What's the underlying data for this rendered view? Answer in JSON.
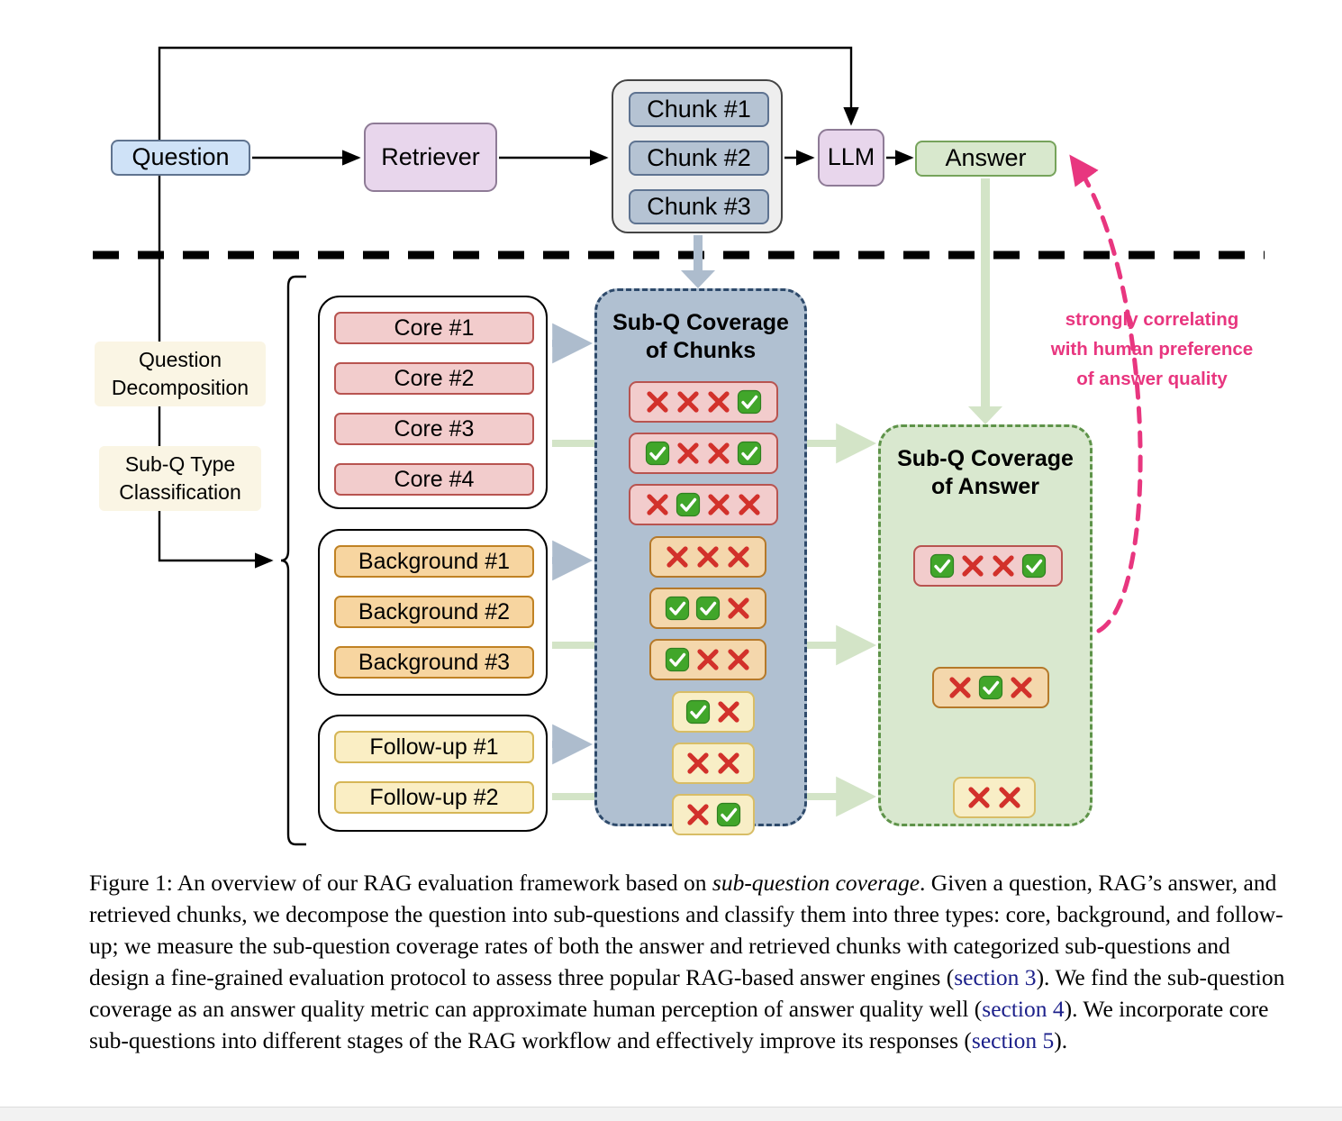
{
  "pipeline": {
    "question": "Question",
    "retriever": "Retriever",
    "llm": "LLM",
    "answer": "Answer",
    "chunks": [
      "Chunk #1",
      "Chunk #2",
      "Chunk #3"
    ]
  },
  "stages": {
    "decomposition": "Question\nDecomposition",
    "classification": "Sub-Q Type\nClassification"
  },
  "subquestions": {
    "core": [
      "Core #1",
      "Core #2",
      "Core #3",
      "Core #4"
    ],
    "background": [
      "Background #1",
      "Background #2",
      "Background #3"
    ],
    "followup": [
      "Follow-up #1",
      "Follow-up #2"
    ]
  },
  "panels": {
    "chunks": {
      "title": "Sub-Q Coverage\nof Chunks",
      "rows": [
        {
          "type": "core",
          "marks": [
            "cross",
            "cross",
            "cross",
            "check"
          ]
        },
        {
          "type": "core",
          "marks": [
            "check",
            "cross",
            "cross",
            "check"
          ]
        },
        {
          "type": "core",
          "marks": [
            "cross",
            "check",
            "cross",
            "cross"
          ]
        },
        {
          "type": "background",
          "marks": [
            "cross",
            "cross",
            "cross"
          ]
        },
        {
          "type": "background",
          "marks": [
            "check",
            "check",
            "cross"
          ]
        },
        {
          "type": "background",
          "marks": [
            "check",
            "cross",
            "cross"
          ]
        },
        {
          "type": "followup",
          "marks": [
            "check",
            "cross"
          ]
        },
        {
          "type": "followup",
          "marks": [
            "cross",
            "cross"
          ]
        },
        {
          "type": "followup",
          "marks": [
            "cross",
            "check"
          ]
        }
      ]
    },
    "answer": {
      "title": "Sub-Q Coverage\nof Answer",
      "rows": [
        {
          "type": "core",
          "marks": [
            "check",
            "cross",
            "cross",
            "check"
          ]
        },
        {
          "type": "background",
          "marks": [
            "cross",
            "check",
            "cross"
          ]
        },
        {
          "type": "followup",
          "marks": [
            "cross",
            "cross"
          ]
        }
      ]
    }
  },
  "annotation": {
    "line1": "strongly correlating",
    "line2": "with human preference",
    "line3": "of answer quality"
  },
  "caption": {
    "label": "Figure 1:",
    "part1": " An overview of our RAG evaluation framework based on ",
    "italic1": "sub-question coverage",
    "part2": ". Given a question, RAG’s answer, and retrieved chunks, we decompose the question into sub-questions and classify them into three types: core, background, and follow-up; we measure the sub-question coverage rates of both the answer and retrieved chunks with categorized sub-questions and design a fine-grained evaluation protocol to assess three popular RAG-based answer engines (",
    "link1": "section 3",
    "part3": "). We find the sub-question coverage as an answer quality metric can approximate human perception of answer quality well (",
    "link2": "section 4",
    "part4": "). We incorporate core sub-questions into different stages of the RAG workflow and effectively improve its responses (",
    "link3": "section 5",
    "part5": ")."
  },
  "colors": {
    "question": "#cfe2f7",
    "retriever": "#e8d6ec",
    "llm": "#e8d6ec",
    "answer": "#d8e8cd",
    "chunk": "#b5c3d3",
    "core": "#f2cccc",
    "background": "#f7d5a0",
    "followup": "#faeec4",
    "panel_chunks": "#b0c0d1",
    "panel_answer": "#d9e8cf",
    "annotation": "#e8367f",
    "check": "#41a62a",
    "cross": "#d2312b",
    "link": "#1b1f8a"
  }
}
